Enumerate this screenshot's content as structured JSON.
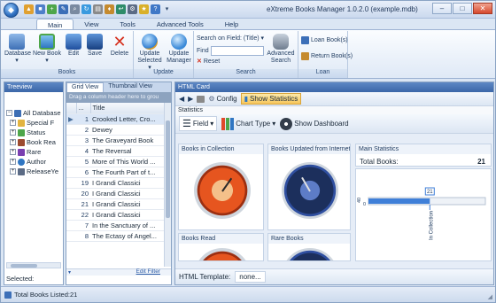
{
  "window": {
    "title": "eXtreme Books Manager 1.0.2.0 (example.mdb)",
    "min": "–",
    "max": "□",
    "close": "✕"
  },
  "tabs": [
    "Main",
    "View",
    "Tools",
    "Advanced Tools",
    "Help"
  ],
  "ribbon": {
    "books": {
      "label": "Books",
      "database": "Database",
      "new_book": "New Book",
      "edit": "Edit",
      "save": "Save",
      "delete": "Delete"
    },
    "update": {
      "label": "Update",
      "update_selected": "Update",
      "update_selected2": "Selected",
      "update_manager": "Update",
      "update_manager2": "Manager"
    },
    "search": {
      "label": "Search",
      "field_label": "Search on Field: (Title)",
      "find_label": "Find",
      "find_value": "",
      "reset": "Reset",
      "advanced": "Advanced",
      "advanced2": "Search"
    },
    "loan": {
      "label": "Loan",
      "loan_books": "Loan Book(s)",
      "return_books": "Return Book(s)"
    }
  },
  "treeview": {
    "title": "Treeview",
    "items": [
      "All Database",
      "Special F",
      "Status",
      "Book Rea",
      "Rare",
      "Author",
      "ReleaseYe"
    ],
    "selected_label": "Selected:"
  },
  "grid": {
    "tabs": [
      "Grid View",
      "Thumbnail View"
    ],
    "group_hint": "Drag a column header here to grou",
    "headers": [
      "...",
      "Title"
    ],
    "rows": [
      {
        "num": "1",
        "title": "Crooked Letter, Cro..."
      },
      {
        "num": "2",
        "title": "Dewey"
      },
      {
        "num": "3",
        "title": "The Graveyard Book"
      },
      {
        "num": "4",
        "title": "The Reversal"
      },
      {
        "num": "5",
        "title": "More of This World ..."
      },
      {
        "num": "6",
        "title": "The Fourth Part of t..."
      },
      {
        "num": "19",
        "title": "I Grandi Classici"
      },
      {
        "num": "20",
        "title": "I Grandi Classici"
      },
      {
        "num": "21",
        "title": "I Grandi Classici"
      },
      {
        "num": "22",
        "title": "I Grandi Classici"
      },
      {
        "num": "7",
        "title": "In the Sanctuary of ..."
      },
      {
        "num": "8",
        "title": "The Ectasy of Angel..."
      }
    ],
    "edit_filter": "Edit Filter"
  },
  "html_card": {
    "title": "HTML Card",
    "config": "Config",
    "show_statistics": "Show Statistics",
    "statistics_label": "Statistics",
    "field": "Field",
    "chart_type": "Chart Type",
    "show_dashboard": "Show Dashboard",
    "cards": {
      "books_in_collection": "Books in Collection",
      "books_updated": "Books Updated from Internet",
      "books_read": "Books Read",
      "rare_books": "Rare Books"
    },
    "main_stats": {
      "title": "Main Statistics",
      "total_label": "Total Books:",
      "total_value": "21"
    },
    "mini_chart": {
      "value_label": "21",
      "axis_top": "40",
      "axis_bottom": "0",
      "category": "In Collection"
    },
    "template_label": "HTML Template:",
    "template_value": "none..."
  },
  "status": {
    "total": "Total Books Listed:21"
  },
  "chart_data": {
    "type": "bar",
    "categories": [
      "In Collection"
    ],
    "values": [
      21
    ],
    "ylim": [
      0,
      40
    ],
    "data_labels": [
      "21"
    ]
  }
}
